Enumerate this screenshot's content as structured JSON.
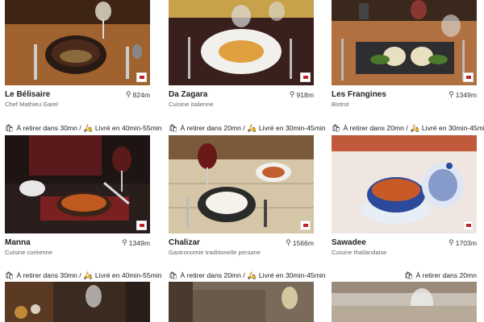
{
  "icons": {
    "pickup": "shopping-bag-icon",
    "delivery": "scooter-icon",
    "location": "location-pin-icon"
  },
  "colors": {
    "text": "#222222",
    "subtitle": "#666666",
    "badge_red": "#c4202a"
  },
  "restaurants": [
    {
      "name": "Le Bélisaire",
      "subtitle": "Chef Mathieu Garel",
      "distance": "824m",
      "pickup": "",
      "delivery": ""
    },
    {
      "name": "Da Zagara",
      "subtitle": "Cuisine italienne",
      "distance": "918m",
      "pickup": "",
      "delivery": ""
    },
    {
      "name": "Les Frangines",
      "subtitle": "Bistrot",
      "distance": "1349m",
      "pickup": "",
      "delivery": ""
    },
    {
      "name": "Manna",
      "subtitle": "Cuisine coréenne",
      "distance": "1349m",
      "pickup": "À retirer dans 30mn /",
      "delivery": "Livré en 40min-55min"
    },
    {
      "name": "Chalizar",
      "subtitle": "Gastronomie traditionelle persane",
      "distance": "1566m",
      "pickup": "À retirer dans 20mn /",
      "delivery": "Livré en 30min-45min"
    },
    {
      "name": "Sawadee",
      "subtitle": "Cuisine thaïlandaise",
      "distance": "1703m",
      "pickup": "À retirer dans 20mn /",
      "delivery": "Livré en 30min-45min"
    },
    {
      "name": "",
      "subtitle": "",
      "distance": "",
      "pickup": "À retirer dans 30mn /",
      "delivery": "Livré en 40min-55min"
    },
    {
      "name": "",
      "subtitle": "",
      "distance": "",
      "pickup": "À retirer dans 20mn /",
      "delivery": "Livré en 30min-45min"
    },
    {
      "name": "",
      "subtitle": "",
      "distance": "",
      "pickup": "À retirer dans 20mn",
      "delivery": ""
    }
  ]
}
